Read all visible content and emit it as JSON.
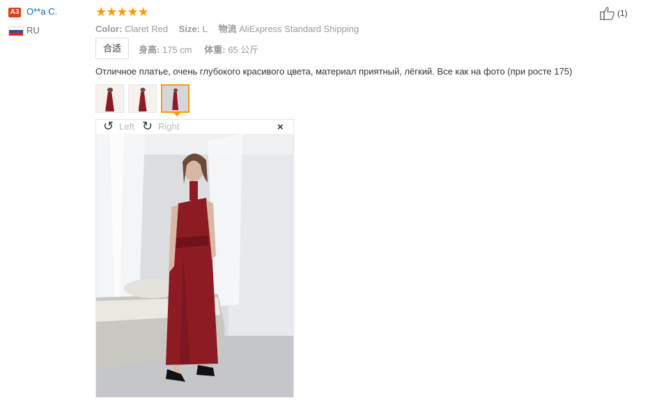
{
  "reviewer": {
    "level_badge": "A3",
    "name": "O**a C.",
    "country": "RU",
    "flag_colors": [
      "#ffffff",
      "#2c4fa8",
      "#d52b1e"
    ]
  },
  "rating": {
    "stars": "★★★★★",
    "value": 5,
    "color": "#ff9900"
  },
  "attributes": {
    "color_label": "Color:",
    "color_value": "Claret Red",
    "size_label": "Size:",
    "size_value": "L",
    "shipping_label": "物流",
    "shipping_value": "AliExpress Standard Shipping"
  },
  "fit": {
    "button_label": "合适",
    "height_label": "身高:",
    "height_value": "175 cm",
    "weight_label": "体重:",
    "weight_value": "65 公斤"
  },
  "review_text": "Отличное платье, очень глубокого красивого цвета, материал приятный, лёгкий. Все как на фото (при росте 175)",
  "viewer": {
    "rotate_left_label": "Left",
    "rotate_right_label": "Right",
    "rotate_left_icon": "↺",
    "rotate_right_icon": "↻",
    "close_icon": "×"
  },
  "likes": {
    "count": "(1)"
  },
  "colors": {
    "accent": "#ff9900",
    "link": "#0066c0",
    "dress": "#8c1b24",
    "badge": "#e23c17"
  }
}
